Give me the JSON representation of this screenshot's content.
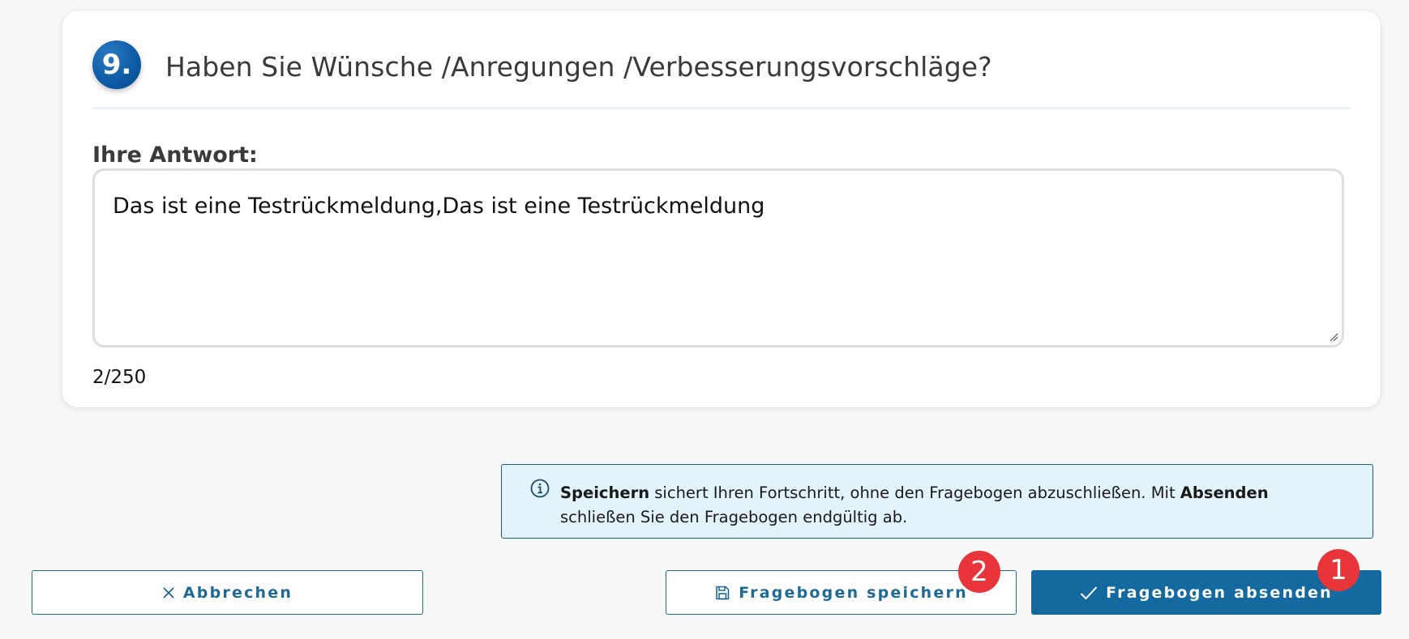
{
  "question": {
    "number": "9.",
    "title": "Haben Sie Wünsche /Anregungen /Verbesserungsvorschläge?",
    "answer_label": "Ihre Antwort:",
    "answer_value": "Das ist eine Testrückmeldung,Das ist eine Testrückmeldung",
    "counter": "2/250"
  },
  "info": {
    "bold_1": "Speichern",
    "text_1": " sichert Ihren Fortschritt, ohne den Fragebogen abzuschließen. Mit ",
    "bold_2": "Absenden",
    "text_2": " schließen Sie den Fragebogen endgültig ab."
  },
  "buttons": {
    "cancel": "Abbrechen",
    "save": "Fragebogen speichern",
    "submit": "Fragebogen absenden"
  },
  "badges": {
    "submit": "1",
    "save": "2"
  },
  "colors": {
    "primary": "#14699e",
    "badge": "#e8353a",
    "info_bg": "#e3f3fa"
  }
}
